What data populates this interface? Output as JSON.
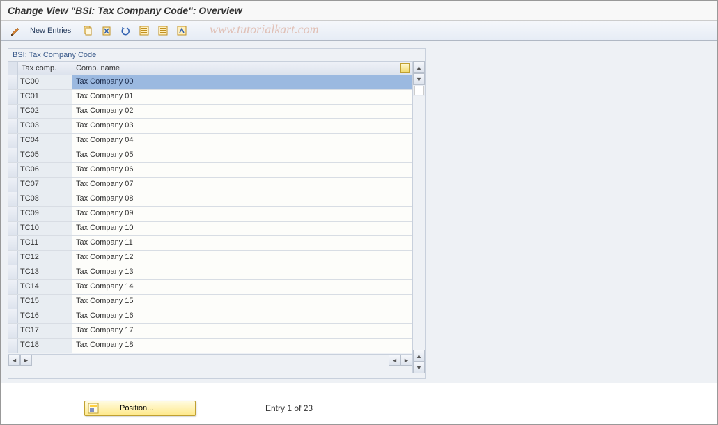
{
  "title": "Change View \"BSI: Tax Company Code\": Overview",
  "toolbar": {
    "new_entries_label": "New Entries"
  },
  "watermark": "www.tutorialkart.com",
  "panel": {
    "title": "BSI: Tax Company Code",
    "columns": {
      "code": "Tax comp.",
      "name": "Comp. name"
    },
    "rows": [
      {
        "code": "TC00",
        "name": "Tax Company 00",
        "selected": true
      },
      {
        "code": "TC01",
        "name": "Tax Company 01"
      },
      {
        "code": "TC02",
        "name": "Tax Company 02"
      },
      {
        "code": "TC03",
        "name": "Tax Company 03"
      },
      {
        "code": "TC04",
        "name": "Tax Company 04"
      },
      {
        "code": "TC05",
        "name": "Tax Company 05"
      },
      {
        "code": "TC06",
        "name": "Tax Company 06"
      },
      {
        "code": "TC07",
        "name": "Tax Company 07"
      },
      {
        "code": "TC08",
        "name": "Tax Company 08"
      },
      {
        "code": "TC09",
        "name": "Tax Company 09"
      },
      {
        "code": "TC10",
        "name": "Tax Company 10"
      },
      {
        "code": "TC11",
        "name": "Tax Company 11"
      },
      {
        "code": "TC12",
        "name": "Tax Company 12"
      },
      {
        "code": "TC13",
        "name": "Tax Company 13"
      },
      {
        "code": "TC14",
        "name": "Tax Company 14"
      },
      {
        "code": "TC15",
        "name": "Tax Company 15"
      },
      {
        "code": "TC16",
        "name": "Tax Company 16"
      },
      {
        "code": "TC17",
        "name": "Tax Company 17"
      },
      {
        "code": "TC18",
        "name": "Tax Company 18"
      }
    ]
  },
  "footer": {
    "position_label": "Position...",
    "entry_label": "Entry 1 of 23"
  }
}
